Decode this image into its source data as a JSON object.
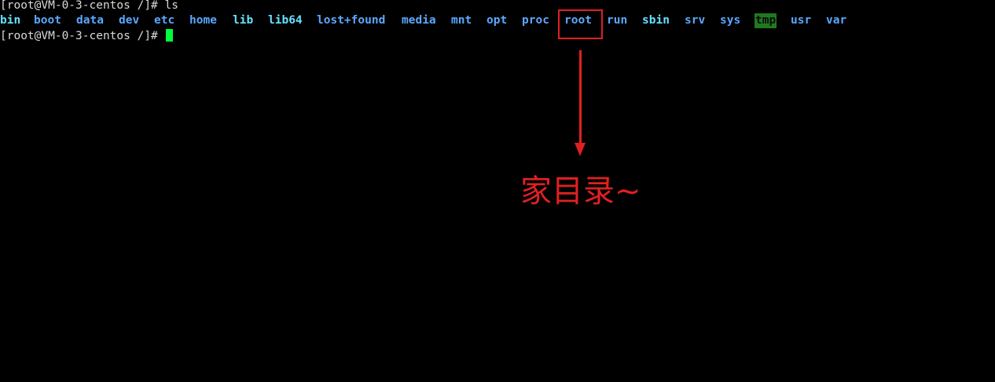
{
  "terminal": {
    "line1": "[root@VM-0-3-centos /]# ls",
    "prompt": "[root@VM-0-3-centos /]# ",
    "colors": {
      "background": "#000000",
      "text": "#d9d9d9",
      "directory": "#5aa8ff",
      "symlink": "#66e0ff",
      "sticky_bg": "#1f7a1f",
      "cursor": "#00ff3a",
      "annotation": "#e02020"
    },
    "listing": [
      {
        "name": "bin",
        "kind": "link"
      },
      {
        "name": "boot",
        "kind": "dir"
      },
      {
        "name": "data",
        "kind": "dir"
      },
      {
        "name": "dev",
        "kind": "dir"
      },
      {
        "name": "etc",
        "kind": "dir"
      },
      {
        "name": "home",
        "kind": "dir"
      },
      {
        "name": "lib",
        "kind": "link"
      },
      {
        "name": "lib64",
        "kind": "link"
      },
      {
        "name": "lost+found",
        "kind": "dir"
      },
      {
        "name": "media",
        "kind": "dir"
      },
      {
        "name": "mnt",
        "kind": "dir"
      },
      {
        "name": "opt",
        "kind": "dir"
      },
      {
        "name": "proc",
        "kind": "dir"
      },
      {
        "name": "root",
        "kind": "dir"
      },
      {
        "name": "run",
        "kind": "dir"
      },
      {
        "name": "sbin",
        "kind": "link"
      },
      {
        "name": "srv",
        "kind": "dir"
      },
      {
        "name": "sys",
        "kind": "dir"
      },
      {
        "name": "tmp",
        "kind": "sticky"
      },
      {
        "name": "usr",
        "kind": "dir"
      },
      {
        "name": "var",
        "kind": "dir"
      }
    ]
  },
  "annotation": {
    "text": "家目录~",
    "icon": "arrow-down-icon"
  }
}
